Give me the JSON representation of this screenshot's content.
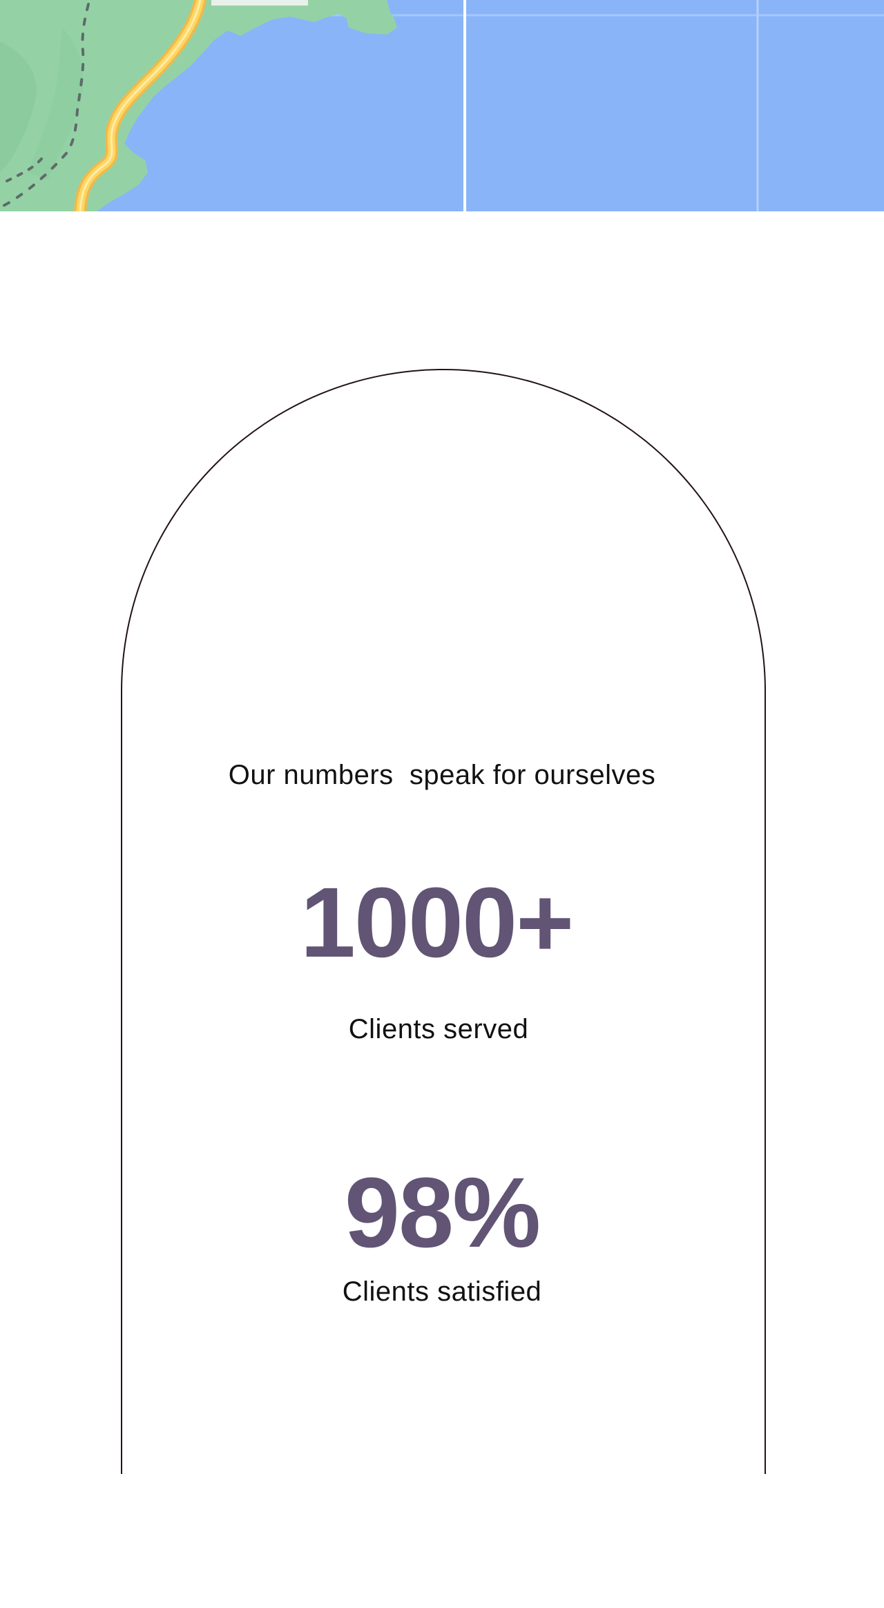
{
  "map": {
    "water_color": "#8ab4f8",
    "land_color": "#94d2a5",
    "road_color": "#fdd663"
  },
  "stats": {
    "heading": "Our numbers  speak for ourselves",
    "items": [
      {
        "value": "1000+",
        "label": "Clients served"
      },
      {
        "value": "98%",
        "label": "Clients satisfied"
      }
    ],
    "accent_color": "#615474"
  }
}
